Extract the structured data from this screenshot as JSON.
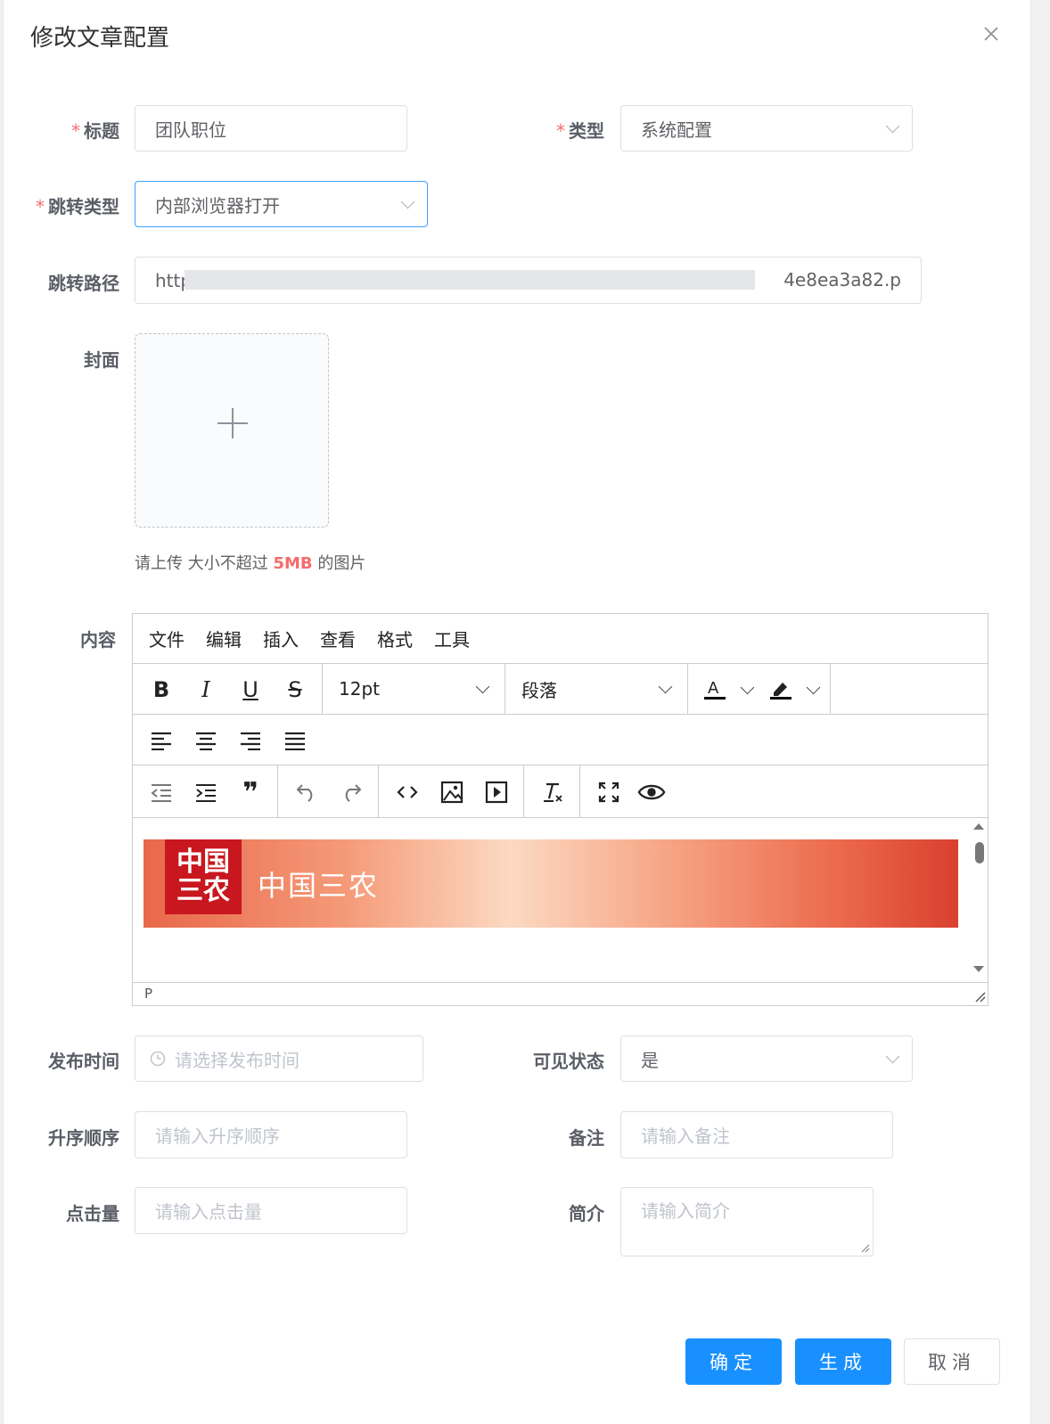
{
  "dialog": {
    "title": "修改文章配置"
  },
  "form": {
    "title_label": "标题",
    "title_value": "团队职位",
    "type_label": "类型",
    "type_value": "系统配置",
    "jump_type_label": "跳转类型",
    "jump_type_value": "内部浏览器打开",
    "jump_path_label": "跳转路径",
    "jump_path_start": "http",
    "jump_path_end": "4e8ea3a82.p",
    "cover_label": "封面",
    "upload_tip_pre": "请上传 大小不超过",
    "upload_tip_size": "5MB",
    "upload_tip_post": "的图片",
    "content_label": "内容",
    "publish_time_label": "发布时间",
    "publish_time_placeholder": "请选择发布时间",
    "visible_label": "可见状态",
    "visible_value": "是",
    "order_label": "升序顺序",
    "order_placeholder": "请输入升序顺序",
    "remark_label": "备注",
    "remark_placeholder": "请输入备注",
    "clicks_label": "点击量",
    "clicks_placeholder": "请输入点击量",
    "intro_label": "简介",
    "intro_placeholder": "请输入简介"
  },
  "editor": {
    "menus": [
      "文件",
      "编辑",
      "插入",
      "查看",
      "格式",
      "工具"
    ],
    "font_size": "12pt",
    "block_format": "段落",
    "status_path": "P",
    "banner_logo": "中国三农",
    "banner_text": "中国三农"
  },
  "buttons": {
    "confirm": "确定",
    "generate": "生成",
    "cancel": "取消"
  },
  "colors": {
    "primary": "#1890ff",
    "required": "#f56c6c"
  }
}
